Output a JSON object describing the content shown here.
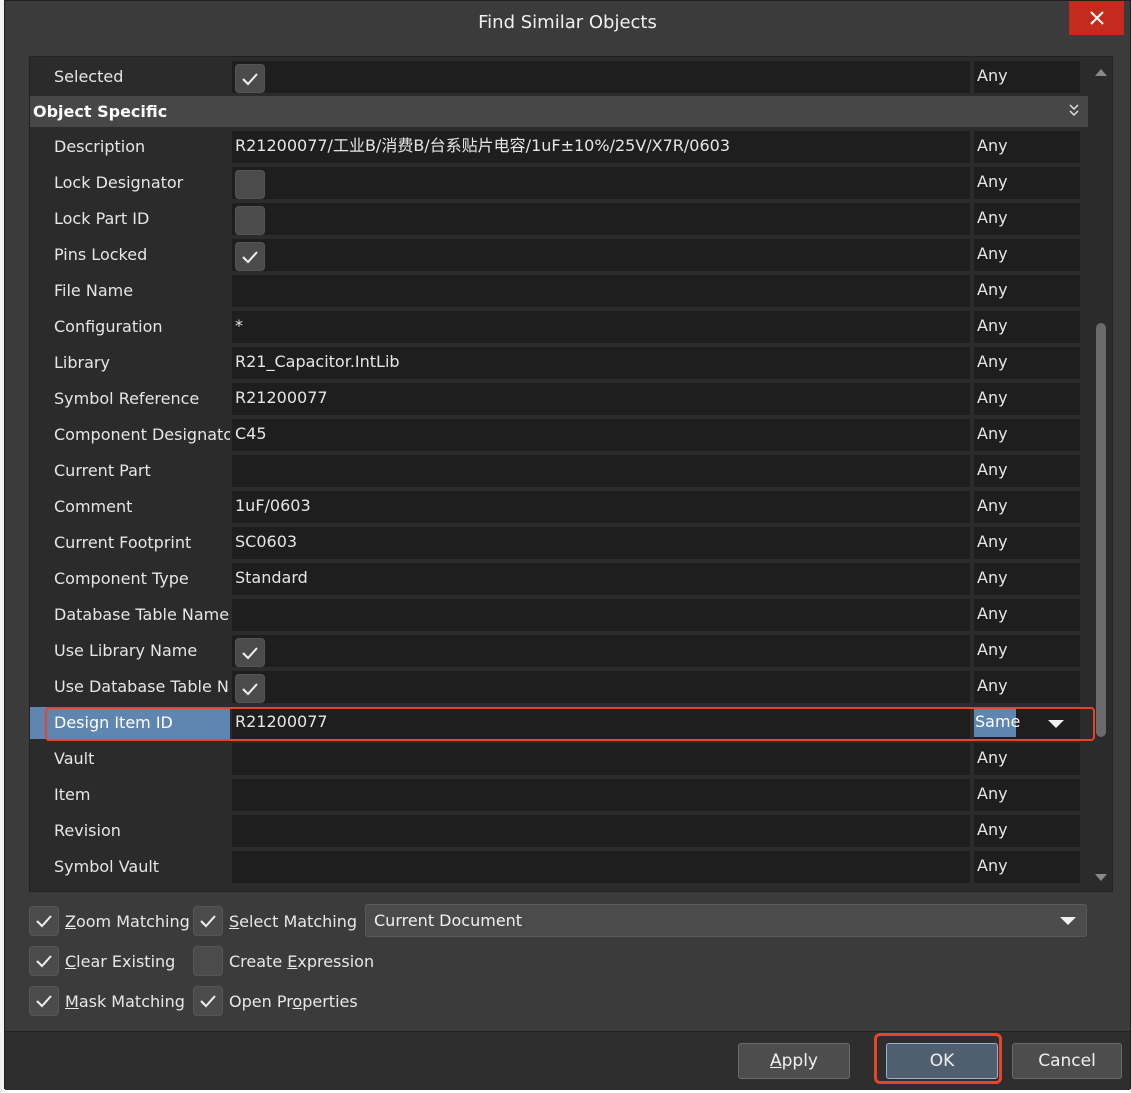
{
  "window": {
    "title": "Find Similar Objects"
  },
  "rows": [
    {
      "label": "Selected",
      "type": "checkbox",
      "checked": true,
      "match": "Any"
    }
  ],
  "section": {
    "title": "Object Specific",
    "collapse_icon": "double-chevron-down"
  },
  "object_rows": [
    {
      "label": "Description",
      "value": "R21200077/工业B/消费B/台系贴片电容/1uF±10%/25V/X7R/0603",
      "match": "Any"
    },
    {
      "label": "Lock Designator",
      "type": "checkbox",
      "checked": false,
      "match": "Any"
    },
    {
      "label": "Lock Part ID",
      "type": "checkbox",
      "checked": false,
      "match": "Any"
    },
    {
      "label": "Pins Locked",
      "type": "checkbox",
      "checked": true,
      "match": "Any"
    },
    {
      "label": "File Name",
      "value": "",
      "match": "Any"
    },
    {
      "label": "Configuration",
      "value": "*",
      "match": "Any"
    },
    {
      "label": "Library",
      "value": "R21_Capacitor.IntLib",
      "match": "Any"
    },
    {
      "label": "Symbol Reference",
      "value": "R21200077",
      "match": "Any"
    },
    {
      "label": "Component Designator",
      "value": "C45",
      "match": "Any"
    },
    {
      "label": "Current Part",
      "value": "",
      "match": "Any"
    },
    {
      "label": "Comment",
      "value": "1uF/0603",
      "match": "Any"
    },
    {
      "label": "Current Footprint",
      "value": "SC0603",
      "match": "Any"
    },
    {
      "label": "Component Type",
      "value": "Standard",
      "match": "Any"
    },
    {
      "label": "Database Table Name",
      "value": "",
      "match": "Any"
    },
    {
      "label": "Use Library Name",
      "type": "checkbox",
      "checked": true,
      "match": "Any"
    },
    {
      "label": "Use Database Table Name",
      "type": "checkbox",
      "checked": true,
      "match": "Any"
    },
    {
      "label": "Design Item ID",
      "value": "R21200077",
      "match": "Same",
      "selected": true
    },
    {
      "label": "Vault",
      "value": "",
      "match": "Any"
    },
    {
      "label": "Item",
      "value": "",
      "match": "Any"
    },
    {
      "label": "Revision",
      "value": "",
      "match": "Any"
    },
    {
      "label": "Symbol Vault",
      "value": "",
      "match": "Any"
    }
  ],
  "options": {
    "zoom_matching": {
      "pre": "",
      "key": "Z",
      "post": "oom Matching",
      "checked": true
    },
    "select_matching": {
      "pre": "",
      "key": "S",
      "post": "elect Matching",
      "checked": true
    },
    "clear_existing": {
      "pre": "",
      "key": "C",
      "post": "lear Existing",
      "checked": true
    },
    "create_expression": {
      "pre": "Create ",
      "key": "E",
      "post": "xpression",
      "checked": false
    },
    "mask_matching": {
      "pre": "",
      "key": "M",
      "post": "ask Matching",
      "checked": true
    },
    "open_properties": {
      "pre": "Open Pr",
      "key": "o",
      "post": "perties",
      "checked": true
    }
  },
  "scope": {
    "value": "Current Document"
  },
  "buttons": {
    "apply": {
      "pre": "",
      "key": "A",
      "post": "pply"
    },
    "ok": "OK",
    "cancel": "Cancel"
  },
  "colors": {
    "accent_red": "#e8442c",
    "selection_blue": "#5f86b0",
    "close_red": "#c42b1c"
  }
}
